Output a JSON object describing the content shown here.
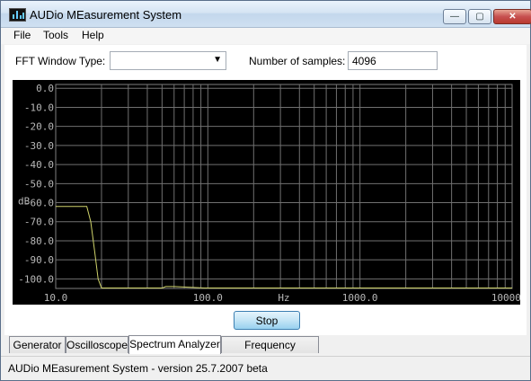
{
  "window": {
    "title": "AUDio MEasurement System",
    "controls": {
      "minimize": "—",
      "maximize": "▢",
      "close": "✕"
    }
  },
  "menu": {
    "items": [
      "File",
      "Tools",
      "Help"
    ]
  },
  "controls": {
    "fft_window_label": "FFT Window Type:",
    "fft_window_value": "",
    "fft_window_arrow": "▼",
    "samples_label": "Number of samples:",
    "samples_value": "4096"
  },
  "chart_data": {
    "type": "line",
    "scale": {
      "x": "log",
      "y": "linear"
    },
    "xlim": [
      10,
      10000
    ],
    "ylim": [
      -105,
      2
    ],
    "x_ticks": [
      10,
      100,
      1000,
      10000
    ],
    "x_tick_labels": [
      "10.0",
      "100.0",
      "1000.0",
      "10000.0"
    ],
    "y_ticks": [
      0,
      -10,
      -20,
      -30,
      -40,
      -50,
      -60,
      -70,
      -80,
      -90,
      -100
    ],
    "y_tick_labels": [
      "0.0",
      "-10.0",
      "-20.0",
      "-30.0",
      "-40.0",
      "-50.0",
      "-60.0",
      "-70.0",
      "-80.0",
      "-90.0",
      "-100.0"
    ],
    "xlabel": "Hz",
    "ylabel": "dB",
    "grid": true,
    "series": [
      {
        "color": "#cfd36a",
        "x": [
          10,
          16,
          17,
          18,
          19,
          20,
          50,
          53,
          60,
          95,
          100,
          10000
        ],
        "y": [
          -62,
          -62,
          -70,
          -85,
          -100,
          -106,
          -106,
          -104,
          -104,
          -106,
          -106,
          -106
        ]
      }
    ]
  },
  "actions": {
    "stop_label": "Stop"
  },
  "tabs": [
    {
      "label": "Generator",
      "active": false
    },
    {
      "label": "Oscilloscope",
      "active": false
    },
    {
      "label": "Spectrum Analyzer",
      "active": true
    },
    {
      "label": "Frequency Response",
      "active": false
    }
  ],
  "status": {
    "text": "AUDio MEasurement System - version 25.7.2007 beta"
  }
}
